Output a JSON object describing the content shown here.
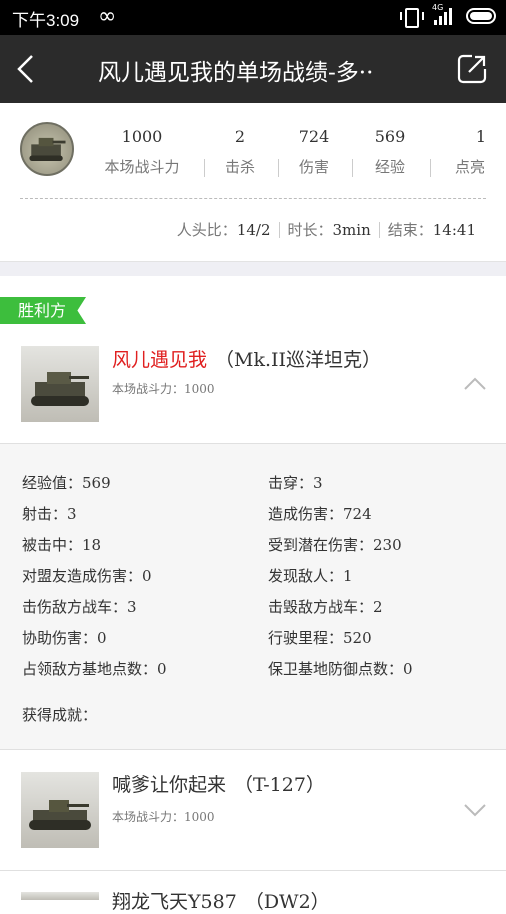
{
  "status_bar": {
    "time": "下午3:09",
    "loop_glyph": "∞",
    "network": "4G"
  },
  "header": {
    "title": "风儿遇见我的单场战绩-多··"
  },
  "summary": {
    "stats": [
      {
        "value": "1000",
        "label": "本场战斗力"
      },
      {
        "value": "2",
        "label": "击杀"
      },
      {
        "value": "724",
        "label": "伤害"
      },
      {
        "value": "569",
        "label": "经验"
      },
      {
        "value": "1",
        "label": "点亮"
      }
    ],
    "kd_label": "人头比：",
    "kd_value": "14/2",
    "duration_label": "时长：",
    "duration_value": "3min",
    "end_label": "结束：",
    "end_value": "14:41"
  },
  "section": {
    "victory_label": "胜利方"
  },
  "players": [
    {
      "name": "风儿遇见我",
      "tank": "（Mk.II巡洋坦克）",
      "power": "本场战斗力：1000",
      "highlight": true
    },
    {
      "name": "喊爹让你起来",
      "tank": "（T-127）",
      "power": "本场战斗力：1000",
      "highlight": false
    },
    {
      "name": "翔龙飞天Y587",
      "tank": "（DW2）",
      "power": "",
      "highlight": false
    }
  ],
  "details": {
    "left": [
      "经验值：569",
      "射击：3",
      "被击中：18",
      "对盟友造成伤害：0",
      "击伤敌方战车：3",
      "协助伤害：0",
      "占领敌方基地点数：0"
    ],
    "right": [
      "击穿：3",
      "造成伤害：724",
      "受到潜在伤害：230",
      "发现敌人：1",
      "击毁敌方战车：2",
      "行驶里程：520",
      "保卫基地防御点数：0"
    ],
    "achievements": "获得成就："
  },
  "colors": {
    "titlebar": "#2b2b2b",
    "victory": "#3dbe3d",
    "highlight_name": "#e02020"
  },
  "icons": [
    "back-icon",
    "share-icon",
    "chevron-up-icon",
    "chevron-down-icon",
    "vibrate-icon",
    "signal-icon",
    "battery-icon"
  ]
}
